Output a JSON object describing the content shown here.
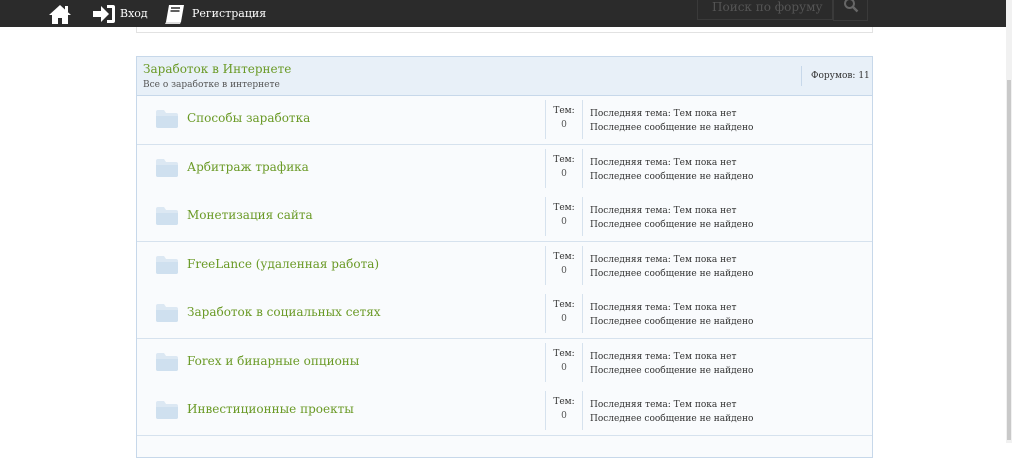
{
  "nav": {
    "home_icon": "home-icon",
    "login_label": "Вход",
    "register_label": "Регистрация",
    "search_placeholder": "Поиск по форуму",
    "search_icon": "search-icon"
  },
  "category": {
    "title": "Заработок в Интернете",
    "description": "Все о заработке в интернете",
    "forums_count_label": "Форумов: 11",
    "topics_label": "Тем:",
    "last_topic_label": "Последняя тема: Тем пока нет",
    "last_message_label": "Последнее сообщение не найдено",
    "forums": [
      {
        "name": "Способы заработка",
        "topics": "0"
      },
      {
        "name": "Арбитраж трафика",
        "topics": "0"
      },
      {
        "name": "Монетизация сайта",
        "topics": "0"
      },
      {
        "name": "FreeLance (удаленная работа)",
        "topics": "0"
      },
      {
        "name": "Заработок в социальных сетях",
        "topics": "0"
      },
      {
        "name": "Forex и бинарные опционы",
        "topics": "0"
      },
      {
        "name": "Инвестиционные проекты",
        "topics": "0"
      }
    ]
  },
  "colors": {
    "topbar": "#2b2b2b",
    "link": "#6a9a26",
    "header_bg": "#e8f0f8",
    "border": "#c7d8ea"
  }
}
